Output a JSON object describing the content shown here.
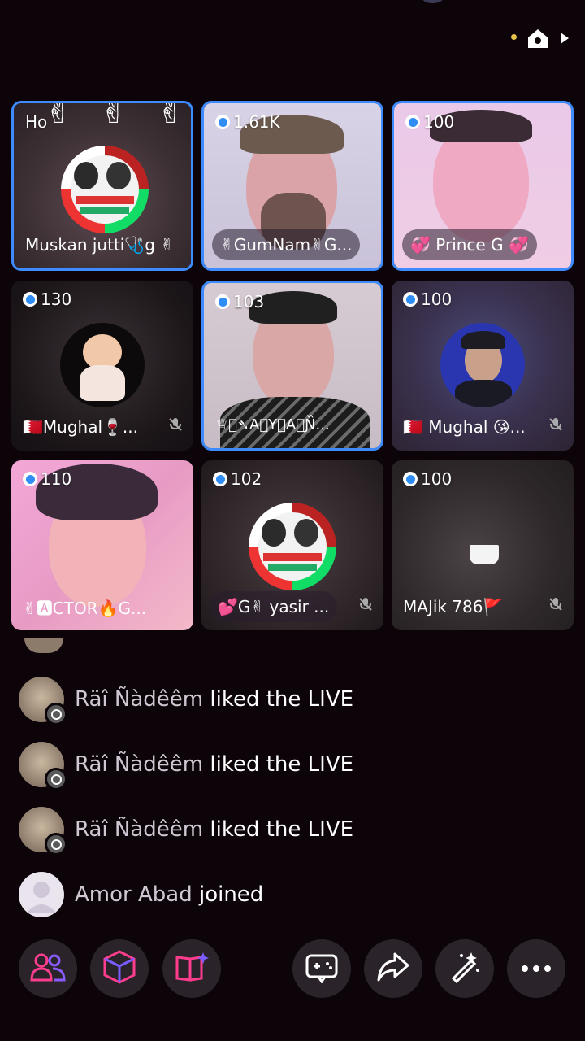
{
  "tiles": [
    {
      "count": "Ho",
      "name": "Muskan jutti🩺g ✌",
      "active": true
    },
    {
      "count": "1.61K",
      "name": "✌GumNam✌G...",
      "active": true
    },
    {
      "count": "100",
      "name": "💞 Prince G 💞",
      "active": true
    },
    {
      "count": "130",
      "name": "🇧🇭Mughal🍷...",
      "muted": true
    },
    {
      "count": "103",
      "name": "♕⃝➴A⃝Y⃝A⃝Ɲ᷈...",
      "active": true
    },
    {
      "count": "100",
      "name": "🇧🇭 Mughal 😘...",
      "muted": true
    },
    {
      "count": "110",
      "name": "✌🅰CTOR🔥G..."
    },
    {
      "count": "102",
      "name": "💕G✌ yasir ...",
      "muted": true
    },
    {
      "count": "100",
      "name": "MAJik 786🚩",
      "muted": true
    }
  ],
  "feed": [
    {
      "user": "Räî Ñàdêêm",
      "action": "liked the LIVE"
    },
    {
      "user": "Räî Ñàdêêm",
      "action": "liked the LIVE"
    },
    {
      "user": "Räî Ñàdêêm",
      "action": "liked the LIVE"
    },
    {
      "user": "Amor Abad",
      "action": "joined"
    }
  ],
  "decor": {
    "peace": "✌"
  },
  "icons": {
    "top": [
      "home-icon",
      "arrow-right-icon"
    ],
    "bottom": [
      "people-icon",
      "cube-icon",
      "book-sparkle-icon",
      "game-controller-icon",
      "share-icon",
      "magic-wand-icon",
      "more-icon"
    ]
  },
  "colors": {
    "accent": "#3d8bff",
    "coin": "#2f8df5",
    "pink": "#ff3d8e"
  }
}
